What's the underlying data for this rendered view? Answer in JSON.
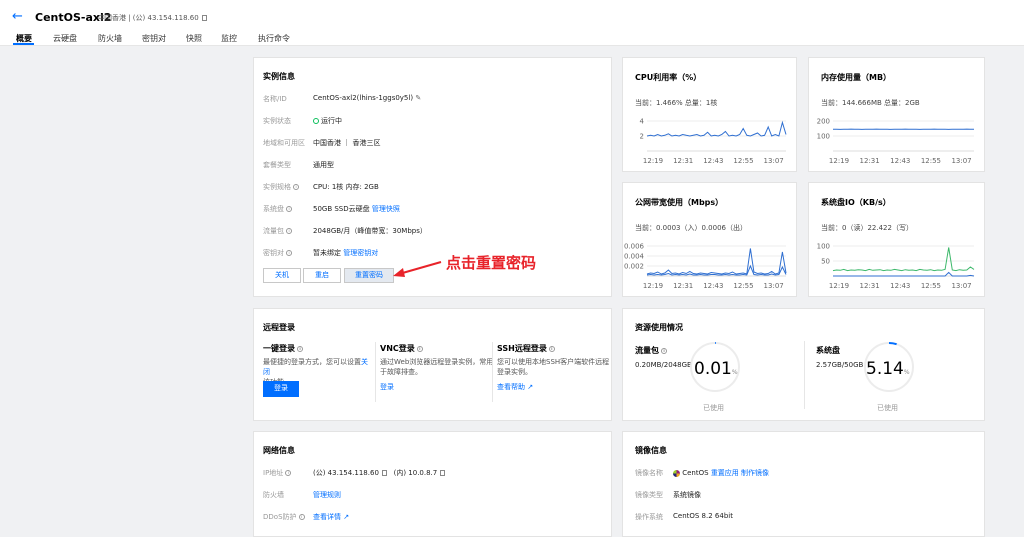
{
  "header": {
    "back_icon": "arrow-left-icon",
    "instance_name": "CentOS-axl2",
    "sub": "中国香港 | (公) 43.154.118.60",
    "tabs": [
      "概要",
      "云硬盘",
      "防火墙",
      "密钥对",
      "快照",
      "监控",
      "执行命令"
    ],
    "active_tab": "概要"
  },
  "instance_info": {
    "title": "实例信息",
    "rows": [
      {
        "label": "名称/ID",
        "value": "CentOS-axl2(lhins-1ggs0y5l)"
      },
      {
        "label": "实例状态",
        "value": "运行中"
      },
      {
        "label": "地域和可用区",
        "value": "中国香港 ｜ 香港三区"
      },
      {
        "label": "套餐类型",
        "value": "通用型"
      },
      {
        "label": "实例规格",
        "value": "CPU: 1核 内存: 2GB"
      },
      {
        "label": "系统盘",
        "value": "50GB SSD云硬盘",
        "link": "管理快照"
      },
      {
        "label": "流量包",
        "value": "2048GB/月（峰值带宽：30Mbps）"
      },
      {
        "label": "密钥对",
        "value": "暂未绑定",
        "link": "管理密钥对"
      }
    ],
    "buttons": [
      "关机",
      "重启",
      "重置密码"
    ]
  },
  "annotation": "点击重置密码",
  "cpu": {
    "title": "CPU利用率（%）",
    "current": "当前：1.466% 总量：1核",
    "times": [
      "12:19",
      "12:31",
      "12:43",
      "12:55",
      "13:07"
    ]
  },
  "memory": {
    "title": "内存使用量（MB）",
    "current": "当前：144.666MB 总量：2GB",
    "times": [
      "12:19",
      "12:31",
      "12:43",
      "12:55",
      "13:07"
    ]
  },
  "bandwidth": {
    "title": "公网带宽使用（Mbps）",
    "current": "当前：0.0003（入）0.0006（出）",
    "times": [
      "12:19",
      "12:31",
      "12:43",
      "12:55",
      "13:07"
    ]
  },
  "diskio": {
    "title": "系统盘IO（KB/s）",
    "current": "当前：0（读）22.422（写）",
    "times": [
      "12:19",
      "12:31",
      "12:43",
      "12:55",
      "13:07"
    ]
  },
  "chart_data": [
    {
      "type": "line",
      "title": "CPU利用率（%）",
      "x": [
        "12:19",
        "12:31",
        "12:43",
        "12:55",
        "13:07"
      ],
      "yticks": [
        2,
        4
      ],
      "series": [
        {
          "values": [
            2.0,
            2.1,
            2.0,
            2.2,
            2.0,
            2.1,
            2.3,
            2.0,
            2.1,
            2.0,
            2.2,
            2.1,
            2.0,
            2.1,
            2.2,
            2.0,
            2.1,
            2.5,
            2.0,
            2.1,
            2.0,
            2.2,
            2.6,
            2.0,
            2.1,
            2.0,
            2.2,
            3.0,
            2.1,
            2.0,
            2.2,
            2.4,
            2.0,
            2.1,
            3.2,
            2.0,
            2.2,
            2.0,
            3.8,
            2.2
          ]
        }
      ]
    },
    {
      "type": "line",
      "title": "内存使用量（MB）",
      "x": [
        "12:19",
        "12:31",
        "12:43",
        "12:55",
        "13:07"
      ],
      "yticks": [
        100,
        200
      ],
      "series": [
        {
          "values": [
            145,
            145,
            144,
            145,
            145,
            146,
            145,
            145,
            144,
            145,
            145,
            145,
            146,
            145,
            145,
            145,
            144,
            145,
            145,
            145,
            146,
            145,
            145,
            145,
            144,
            145,
            145,
            145,
            146,
            145,
            145,
            145,
            144,
            145,
            145,
            145,
            145,
            146,
            145,
            145
          ]
        }
      ]
    },
    {
      "type": "line",
      "title": "公网带宽使用（Mbps）",
      "x": [
        "12:19",
        "12:31",
        "12:43",
        "12:55",
        "13:07"
      ],
      "yticks": [
        0.002,
        0.004,
        0.006
      ],
      "series": [
        {
          "values": [
            0.0004,
            0.0006,
            0.0005,
            0.0008,
            0.0004,
            0.0006,
            0.0012,
            0.0005,
            0.0006,
            0.0004,
            0.0007,
            0.0005,
            0.0009,
            0.0005,
            0.0004,
            0.0006,
            0.0005,
            0.0004,
            0.0007,
            0.0006,
            0.0005,
            0.0004,
            0.0006,
            0.0005,
            0.0008,
            0.0004,
            0.0005,
            0.0006,
            0.0004,
            0.0055,
            0.0008,
            0.0005,
            0.0006,
            0.0004,
            0.0005,
            0.0009,
            0.0004,
            0.0006,
            0.0048,
            0.0006
          ]
        },
        {
          "values": [
            0.0002,
            0.0003,
            0.0002,
            0.0003,
            0.0002,
            0.0003,
            0.0005,
            0.0002,
            0.0003,
            0.0002,
            0.0003,
            0.0002,
            0.0004,
            0.0002,
            0.0002,
            0.0003,
            0.0002,
            0.0002,
            0.0003,
            0.0003,
            0.0002,
            0.0002,
            0.0003,
            0.0002,
            0.0003,
            0.0002,
            0.0002,
            0.0003,
            0.0002,
            0.002,
            0.0003,
            0.0002,
            0.0003,
            0.0002,
            0.0002,
            0.0004,
            0.0002,
            0.0003,
            0.0018,
            0.0003
          ]
        }
      ]
    },
    {
      "type": "line",
      "title": "系统盘IO（KB/s）",
      "x": [
        "12:19",
        "12:31",
        "12:43",
        "12:55",
        "13:07"
      ],
      "yticks": [
        50,
        100
      ],
      "series": [
        {
          "values": [
            18,
            20,
            19,
            22,
            18,
            20,
            19,
            21,
            20,
            18,
            22,
            19,
            20,
            21,
            18,
            20,
            19,
            22,
            20,
            18,
            21,
            19,
            20,
            18,
            22,
            20,
            19,
            21,
            18,
            20,
            19,
            22,
            95,
            20,
            18,
            21,
            19,
            20,
            30,
            22
          ]
        },
        {
          "values": [
            0,
            0,
            0,
            0,
            0,
            0,
            0,
            0,
            0,
            0,
            0,
            0,
            0,
            0,
            0,
            0,
            0,
            0,
            0,
            0,
            0,
            0,
            0,
            0,
            0,
            0,
            0,
            0,
            0,
            0,
            0,
            0,
            12,
            0,
            0,
            0,
            0,
            0,
            2,
            0
          ]
        }
      ]
    }
  ],
  "remote_login": {
    "title": "远程登录",
    "cols": [
      {
        "title": "一键登录",
        "desc1": "最便捷的登录方式，您可以设置",
        "desc_link": "关闭",
        "desc2": "该功能。",
        "button": "登录"
      },
      {
        "title": "VNC登录",
        "desc1": "通过Web浏览器远程登录实例，常用",
        "desc2": "于故障排查。",
        "link": "登录"
      },
      {
        "title": "SSH远程登录",
        "desc1": "您可以使用本地SSH客户端软件远程",
        "desc2": "登录实例。",
        "link": "查看帮助"
      }
    ]
  },
  "resource": {
    "title": "资源使用情况",
    "traffic": {
      "label": "流量包",
      "usage": "0.20MB/2048GB",
      "value": "0.01",
      "unit": "%",
      "caption": "已使用",
      "fraction": 0.0001
    },
    "disk": {
      "label": "系统盘",
      "usage": "2.57GB/50GB",
      "value": "5.14",
      "unit": "%",
      "caption": "已使用",
      "fraction": 0.0514
    }
  },
  "network": {
    "title": "网络信息",
    "ip_label": "IP地址",
    "ip_public": "(公) 43.154.118.60",
    "ip_private": "(内) 10.0.8.7",
    "fw_label": "防火墙",
    "fw_link": "管理规则",
    "ddos_label": "DDoS防护",
    "ddos_link": "查看详情"
  },
  "image": {
    "title": "镜像信息",
    "name_label": "镜像名称",
    "name": "CentOS",
    "reset_link": "重置应用",
    "make_link": "制作镜像",
    "type_label": "镜像类型",
    "type": "系统镜像",
    "os_label": "操作系统",
    "os": "CentOS 8.2 64bit"
  },
  "colors": {
    "accent": "#006eff",
    "cpu_line": "#2f6fd1",
    "io_line": "#3cb86a",
    "annotation": "#e8232a"
  }
}
